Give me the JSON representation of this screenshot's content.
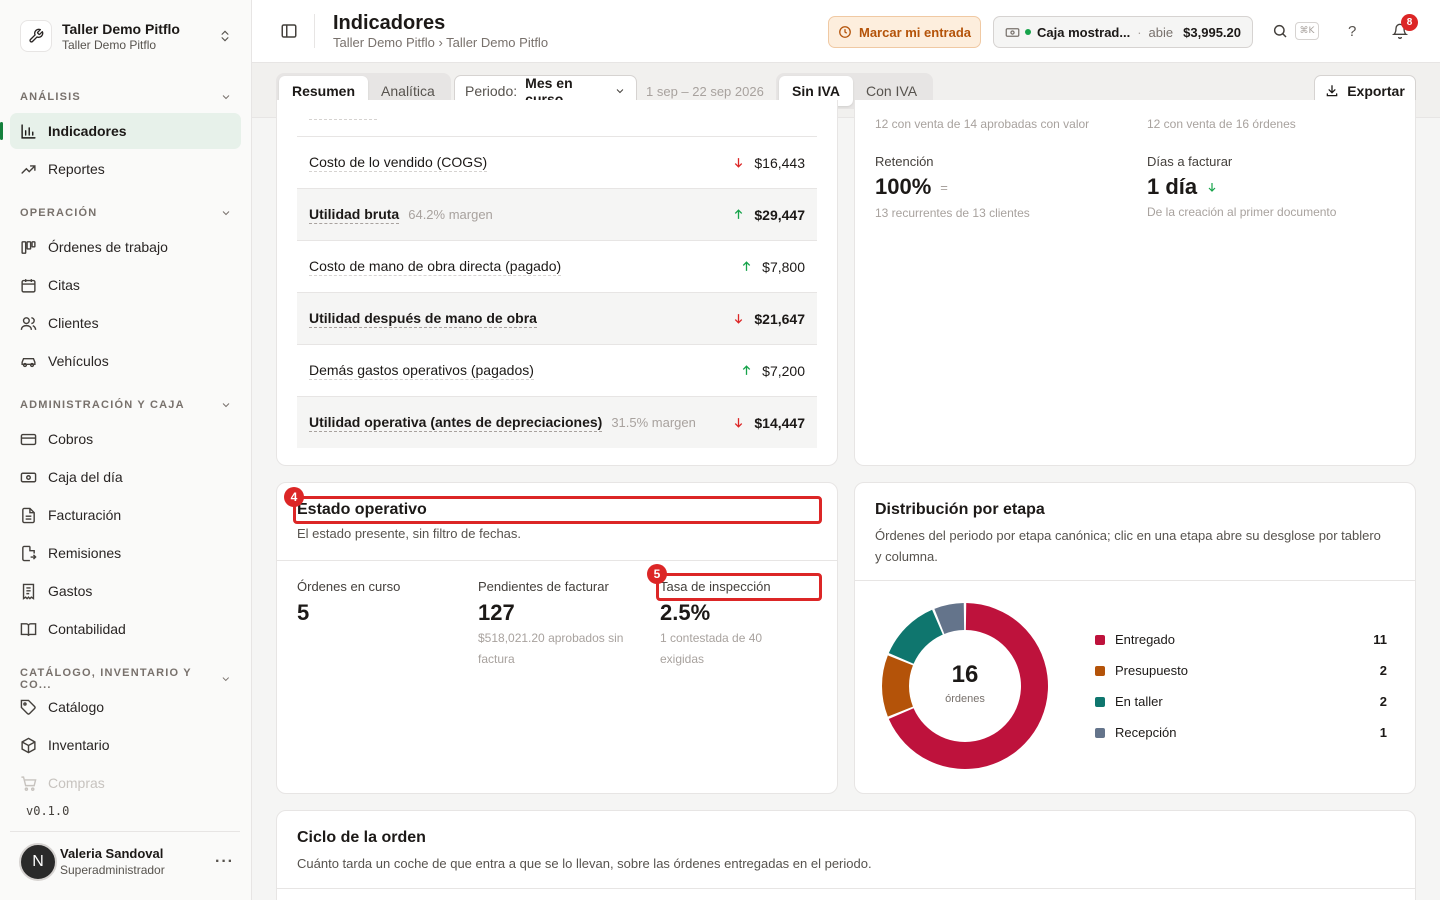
{
  "workspace": {
    "name": "Taller Demo Pitflo",
    "sub": "Taller Demo Pitflo"
  },
  "sidebar": {
    "sections": [
      {
        "label": "ANÁLISIS"
      },
      {
        "label": "OPERACIÓN"
      },
      {
        "label": "ADMINISTRACIÓN Y CAJA"
      },
      {
        "label": "CATÁLOGO, INVENTARIO Y CO..."
      }
    ],
    "items": [
      {
        "label": "Indicadores",
        "icon": "bar-chart-icon",
        "active": true
      },
      {
        "label": "Reportes",
        "icon": "trending-up-icon"
      },
      {
        "label": "Órdenes de trabajo",
        "icon": "kanban-icon"
      },
      {
        "label": "Citas",
        "icon": "calendar-icon"
      },
      {
        "label": "Clientes",
        "icon": "users-icon"
      },
      {
        "label": "Vehículos",
        "icon": "car-icon"
      },
      {
        "label": "Cobros",
        "icon": "credit-card-icon"
      },
      {
        "label": "Caja del día",
        "icon": "cash-icon"
      },
      {
        "label": "Facturación",
        "icon": "file-text-icon"
      },
      {
        "label": "Remisiones",
        "icon": "file-export-icon"
      },
      {
        "label": "Gastos",
        "icon": "receipt-icon"
      },
      {
        "label": "Contabilidad",
        "icon": "book-icon"
      },
      {
        "label": "Catálogo",
        "icon": "tag-icon"
      },
      {
        "label": "Inventario",
        "icon": "package-icon"
      },
      {
        "label": "Compras",
        "icon": "cart-icon"
      }
    ],
    "version": "v0.1.0",
    "user": {
      "initial": "N",
      "name": "Valeria Sandoval",
      "role": "Superadministrador"
    }
  },
  "header": {
    "title": "Indicadores",
    "breadcrumb": "Taller Demo Pitflo › Taller Demo Pitflo",
    "clock_in": "Marcar mi entrada",
    "register": {
      "name": "Caja mostrad...",
      "status": "abie",
      "amount": "$3,995.20"
    },
    "search_shortcut": "⌘K",
    "help": "?",
    "notifications": "8"
  },
  "filters": {
    "tabs": [
      "Resumen",
      "Analítica"
    ],
    "period_label": "Periodo:",
    "period_value": "Mes en curso",
    "range": "1 sep – 22 sep 2026",
    "tax": [
      "Sin IVA",
      "Con IVA"
    ],
    "export": "Exportar"
  },
  "pnl": {
    "rows": [
      {
        "label": "Costo de lo vendido (COGS)",
        "note": "",
        "trend": "down",
        "value": "$16,443",
        "bold": false
      },
      {
        "label": "Utilidad bruta",
        "note": "64.2% margen",
        "trend": "up",
        "value": "$29,447",
        "bold": true
      },
      {
        "label": "Costo de mano de obra directa (pagado)",
        "note": "",
        "trend": "up",
        "value": "$7,800",
        "bold": false
      },
      {
        "label": "Utilidad después de mano de obra",
        "note": "",
        "trend": "down",
        "value": "$21,647",
        "bold": true
      },
      {
        "label": "Demás gastos operativos (pagados)",
        "note": "",
        "trend": "up",
        "value": "$7,200",
        "bold": false
      },
      {
        "label": "Utilidad operativa (antes de depreciaciones)",
        "note": "31.5% margen",
        "trend": "down",
        "value": "$14,447",
        "bold": true
      }
    ]
  },
  "kpis": {
    "top_left_sub": "12 con venta de 14 aprobadas con valor",
    "top_right_sub": "12 con venta de 16 órdenes",
    "retention": {
      "label": "Retención",
      "value": "100%",
      "trend": "=",
      "sub": "13 recurrentes de 13 clientes"
    },
    "billing_days": {
      "label": "Días a facturar",
      "value": "1 día",
      "sub": "De la creación al primer documento"
    }
  },
  "estado": {
    "title": "Estado operativo",
    "desc": "El estado presente, sin filtro de fechas.",
    "marker_title": "4",
    "marker_rate": "5",
    "metrics": [
      {
        "label": "Órdenes en curso",
        "value": "5",
        "sub": ""
      },
      {
        "label": "Pendientes de facturar",
        "value": "127",
        "sub": "$518,021.20 aprobados sin factura"
      },
      {
        "label": "Tasa de inspección",
        "value": "2.5%",
        "sub": "1 contestada de 40 exigidas"
      }
    ]
  },
  "distribucion": {
    "title": "Distribución por etapa",
    "desc": "Órdenes del periodo por etapa canónica; clic en una etapa abre su desglose por tablero y columna.",
    "total": "16",
    "total_label": "órdenes",
    "stages": [
      {
        "name": "Entregado",
        "count": 11,
        "color": "#be123c"
      },
      {
        "name": "Presupuesto",
        "count": 2,
        "color": "#b45309"
      },
      {
        "name": "En taller",
        "count": 2,
        "color": "#0f766e"
      },
      {
        "name": "Recepción",
        "count": 1,
        "color": "#64748b"
      }
    ]
  },
  "ciclo": {
    "title": "Ciclo de la orden",
    "desc": "Cuánto tarda un coche de que entra a que se lo llevan, sobre las órdenes entregadas en el periodo."
  }
}
